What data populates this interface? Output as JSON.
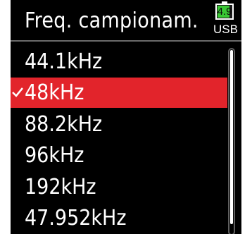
{
  "header": {
    "title": "Freq. campionam.",
    "battery_level": "4.9",
    "battery_fill_fraction": 0.85,
    "power_source": "USB"
  },
  "options": [
    {
      "label": "44.1kHz",
      "selected": false
    },
    {
      "label": "48kHz",
      "selected": true
    },
    {
      "label": "88.2kHz",
      "selected": false
    },
    {
      "label": "96kHz",
      "selected": false
    },
    {
      "label": "192kHz",
      "selected": false
    },
    {
      "label": "47.952kHz",
      "selected": false
    }
  ],
  "scrollbar": {
    "visible_fraction": 0.95
  },
  "colors": {
    "background": "#000000",
    "text": "#ffffff",
    "selection": "#e2242b",
    "battery": "#39c834",
    "divider": "#6a6a6a",
    "scrollbar_track": "#5e5e5e"
  }
}
